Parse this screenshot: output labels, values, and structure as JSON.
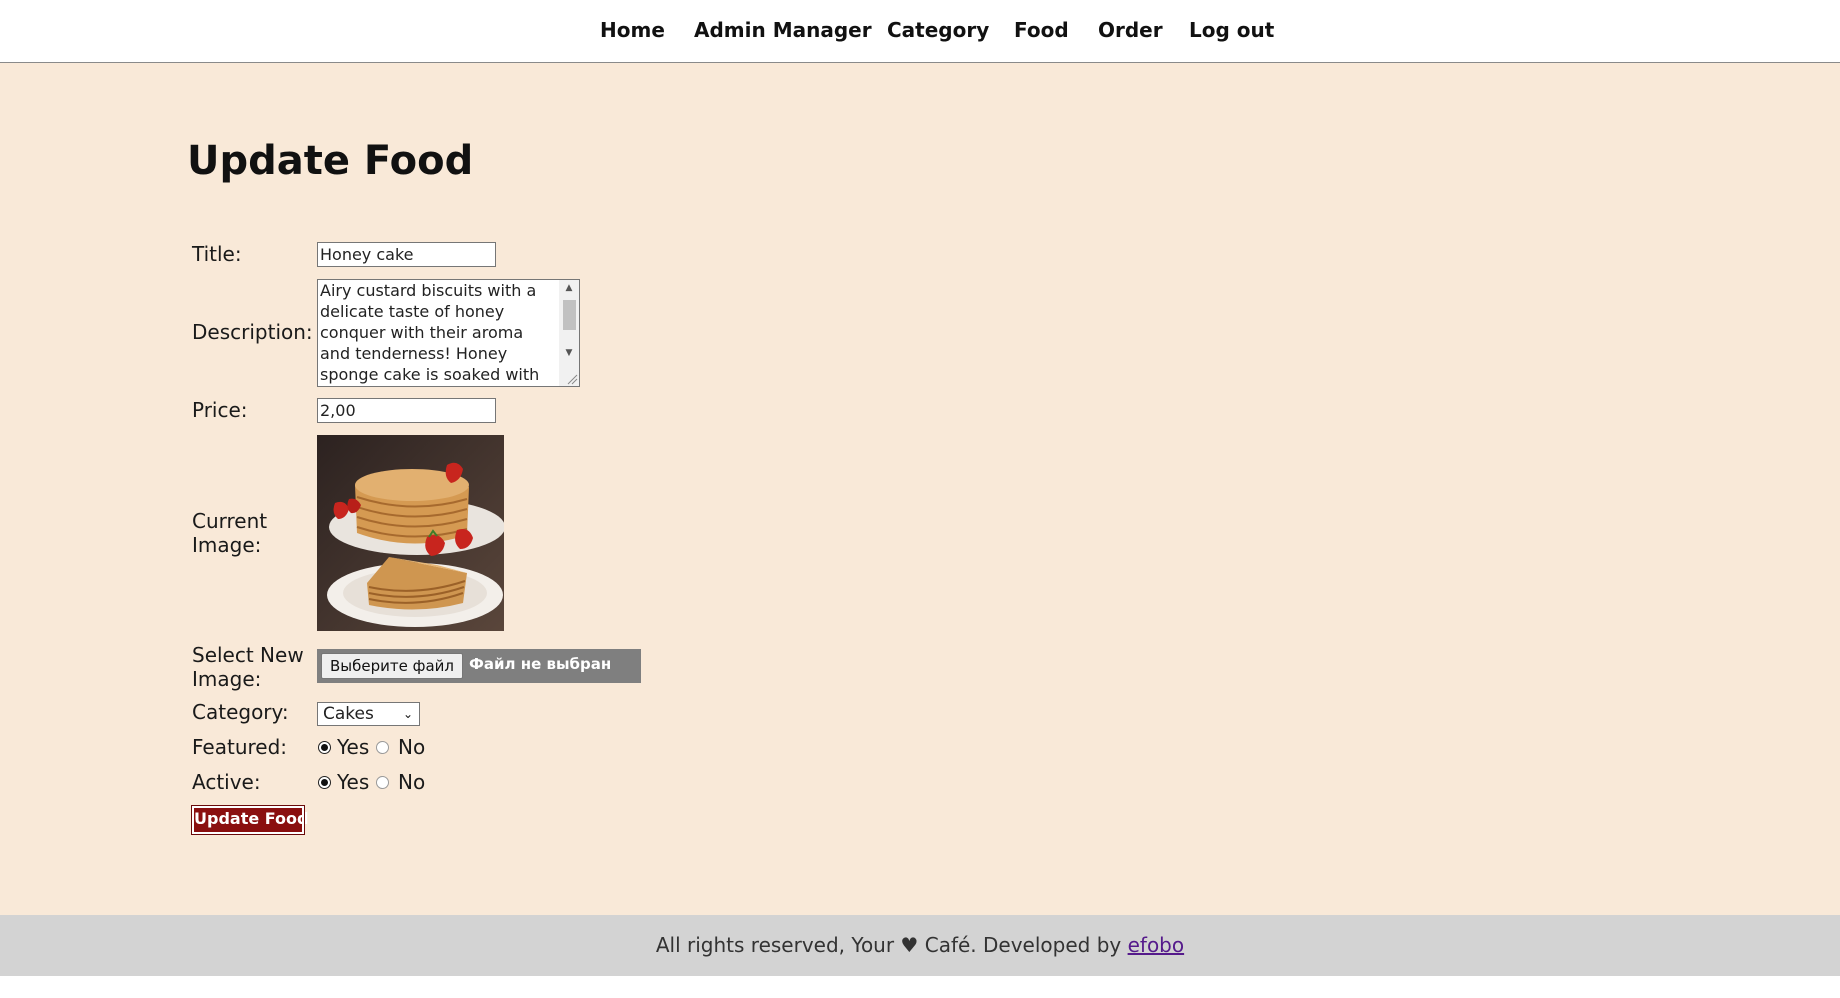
{
  "nav": {
    "items": [
      {
        "label": "Home"
      },
      {
        "label": "Admin Manager"
      },
      {
        "label": "Category"
      },
      {
        "label": "Food"
      },
      {
        "label": "Order"
      },
      {
        "label": "Log out"
      }
    ]
  },
  "page": {
    "title": "Update Food"
  },
  "form": {
    "title_label": "Title:",
    "title_value": "Honey cake",
    "description_label": "Description:",
    "description_value": "Airy custard biscuits with a delicate taste of honey conquer with their aroma and tenderness! Honey sponge cake is soaked with",
    "price_label": "Price:",
    "price_value": "2,00",
    "current_image_label": "Current Image:",
    "new_image_label": "Select New Image:",
    "file_button_label": "Выберите файл",
    "file_status": "Файл не выбран",
    "category_label": "Category:",
    "category_selected": "Cakes",
    "featured_label": "Featured:",
    "featured_value": "Yes",
    "active_label": "Active:",
    "active_value": "Yes",
    "yes_label": "Yes",
    "no_label": "No",
    "submit_label": "Update Food"
  },
  "footer": {
    "text": "All rights reserved, Your ♥ Café. Developed by",
    "link_label": "efobo"
  },
  "colors": {
    "page_background": "#f9e9d8",
    "footer_background": "#d3d3d3",
    "submit_background": "#8a0f0f",
    "link": "#551a8b"
  }
}
